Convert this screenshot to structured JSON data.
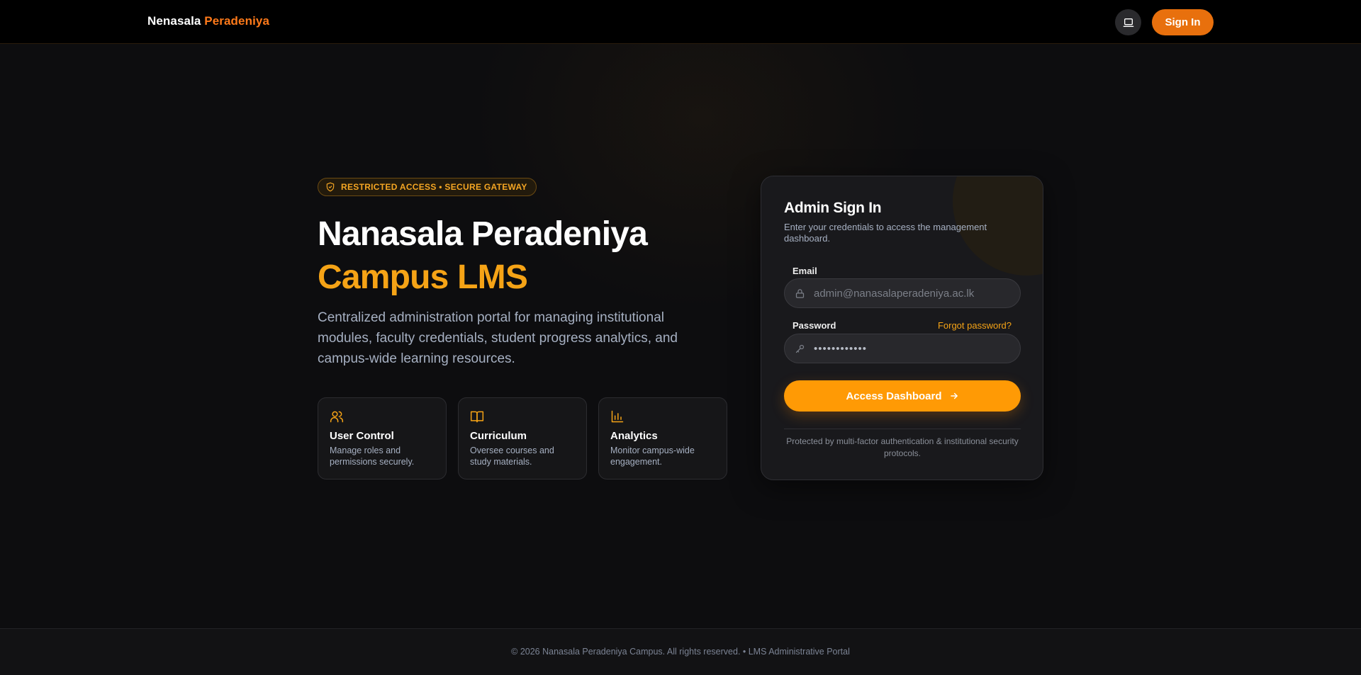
{
  "header": {
    "brand_part1": "Nenasala",
    "brand_part2": "Peradeniya",
    "theme_icon": "laptop-icon",
    "signin_label": "Sign In"
  },
  "hero": {
    "badge_icon": "shield-check-icon",
    "badge_text": "RESTRICTED ACCESS • SECURE GATEWAY",
    "title_line1": "Nanasala Peradeniya",
    "title_line2": "Campus LMS",
    "description": "Centralized administration portal for managing institutional modules, faculty credentials, student progress analytics, and campus-wide learning resources."
  },
  "features": [
    {
      "icon": "users-icon",
      "title": "User Control",
      "desc": "Manage roles and permissions securely."
    },
    {
      "icon": "book-open-icon",
      "title": "Curriculum",
      "desc": "Oversee courses and study materials."
    },
    {
      "icon": "bar-chart-icon",
      "title": "Analytics",
      "desc": "Monitor campus-wide engagement."
    }
  ],
  "login": {
    "title": "Admin Sign In",
    "subtitle": "Enter your credentials to access the management dashboard.",
    "email_label": "Email",
    "email_placeholder": "admin@nanasalaperadeniya.ac.lk",
    "password_label": "Password",
    "forgot_label": "Forgot password?",
    "password_value": "••••••••••••",
    "submit_label": "Access Dashboard",
    "protected_note": "Protected by multi-factor authentication & institutional security protocols."
  },
  "footer": {
    "text": "© 2026 Nanasala Peradeniya Campus. All rights reserved. • LMS Administrative Portal"
  },
  "colors": {
    "accent": "#ff9a05",
    "brand_orange": "#e8700d",
    "background": "#0d0d0f",
    "card": "#19191c"
  }
}
